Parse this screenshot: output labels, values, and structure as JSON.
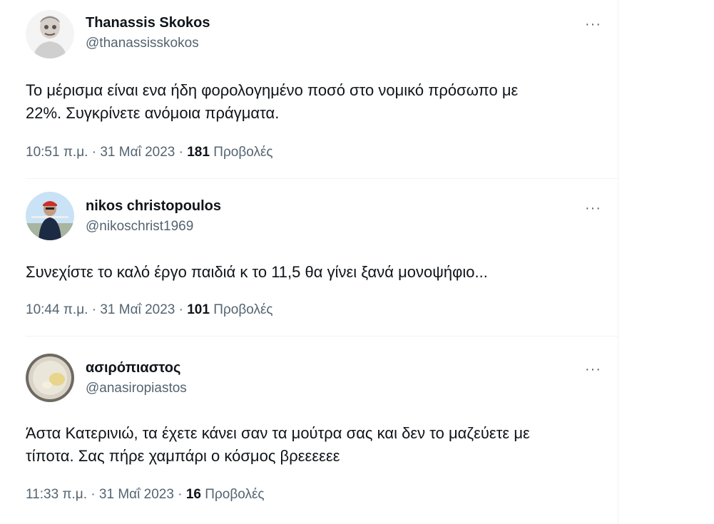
{
  "tweets": [
    {
      "name": "Thanassis Skokos",
      "handle": "@thanassisskokos",
      "text_lines": [
        "Το μέρισμα είναι ενα ήδη φορολογημένο ποσό στο νομικό πρόσωπο με",
        "22%. Συγκρίνετε ανόμοια πράγματα."
      ],
      "time": "10:51 π.μ.",
      "date": "31 Μαΐ 2023",
      "views": "181",
      "views_label": "Προβολές",
      "more": "···",
      "sep": "·"
    },
    {
      "name": "nikos christopoulos",
      "handle": "@nikoschrist1969",
      "text_lines": [
        "Συνεχίστε το καλό έργο παιδιά κ το 11,5 θα γίνει ξανά μονοψήφιο..."
      ],
      "time": "10:44 π.μ.",
      "date": "31 Μαΐ 2023",
      "views": "101",
      "views_label": "Προβολές",
      "more": "···",
      "sep": "·"
    },
    {
      "name": "ασιρόπιαστος",
      "handle": "@anasiropiastos",
      "text_lines": [
        "Άστα Κατερινιώ, τα έχετε κάνει σαν τα μούτρα σας και δεν το μαζεύετε με",
        "τίποτα. Σας πήρε χαμπάρι ο κόσμος βρεεεεεε"
      ],
      "time": "11:33 π.μ.",
      "date": "31 Μαΐ 2023",
      "views": "16",
      "views_label": "Προβολές",
      "more": "···",
      "sep": "·"
    }
  ],
  "colors": {
    "text": "#0f1419",
    "secondary": "#536471",
    "divider": "#eff3f4"
  }
}
